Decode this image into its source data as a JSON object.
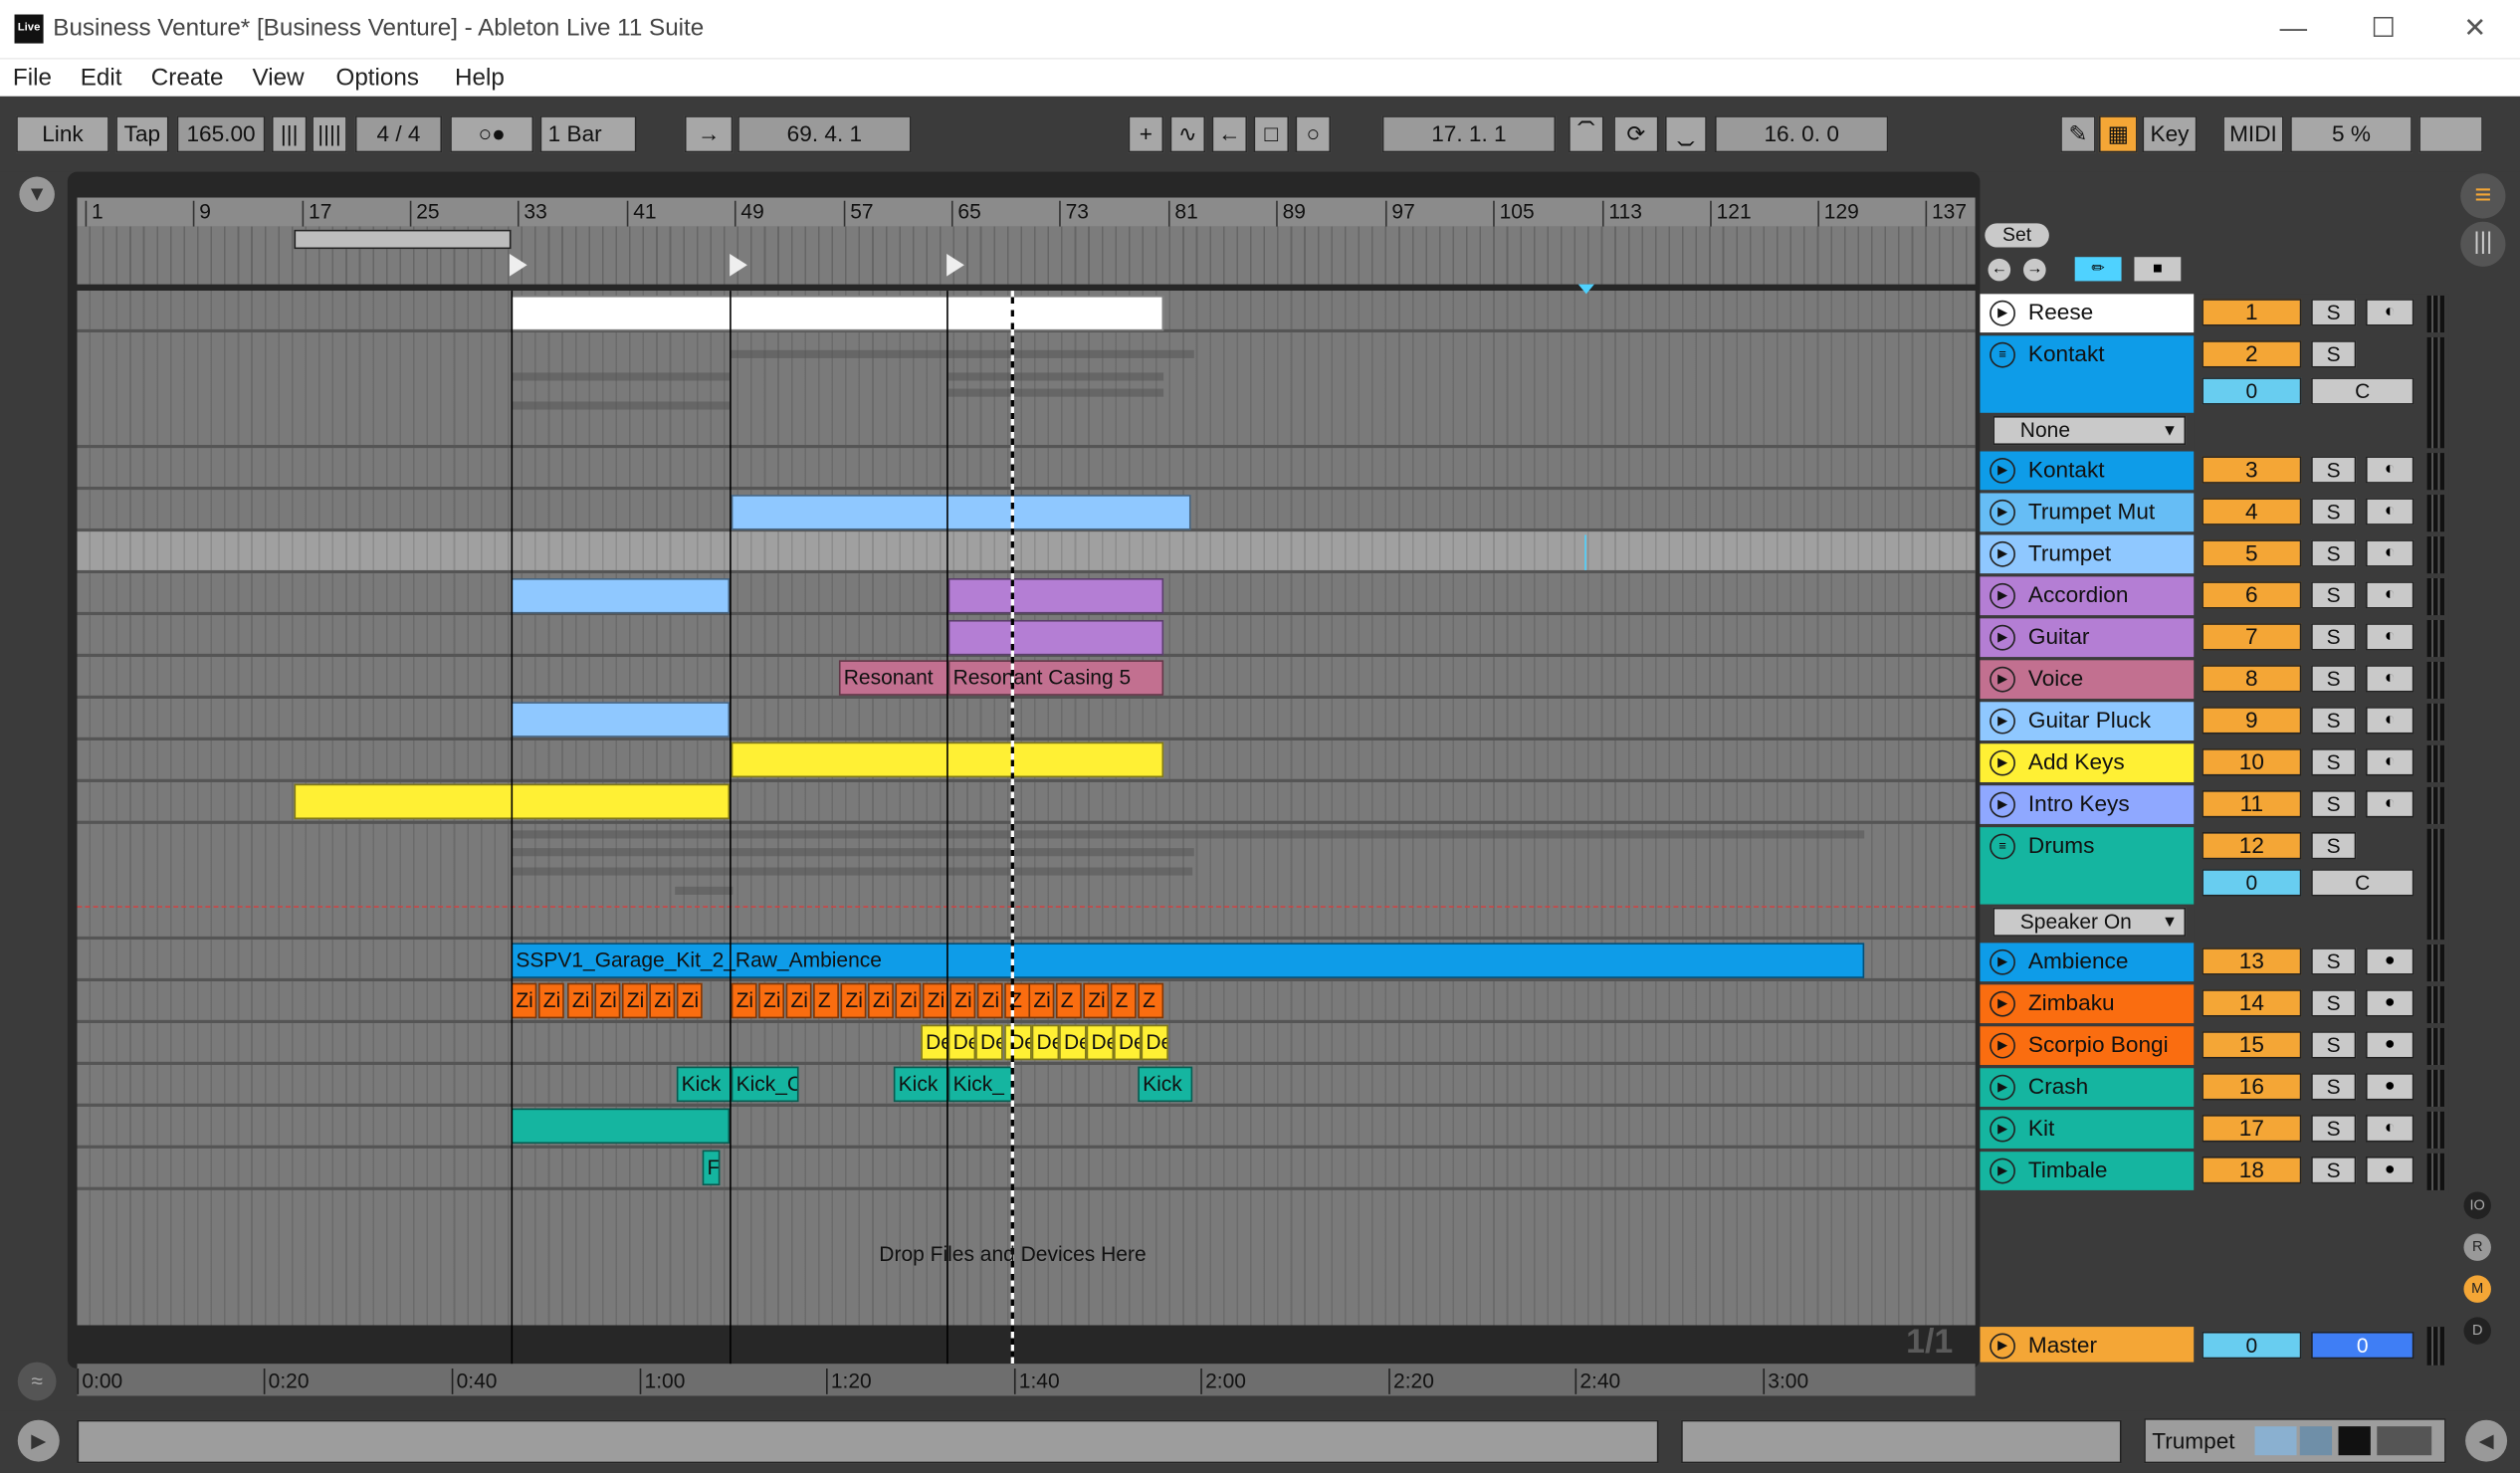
{
  "window": {
    "title": "Business Venture*  [Business Venture] - Ableton Live 11 Suite",
    "logo_text": "Live"
  },
  "menu": [
    "File",
    "Edit",
    "Create",
    "View",
    "Options",
    "Help"
  ],
  "transport": {
    "link": "Link",
    "tap": "Tap",
    "tempo": "165.00",
    "signature": "4 / 4",
    "metro_mode": "○●",
    "quantize": "1 Bar",
    "position": "69.   4.   1",
    "punch_in": "17.   1.   1",
    "punch_length": "16.   0.   0",
    "key": "Key",
    "midi": "MIDI",
    "cpu": "5 %"
  },
  "beat_ruler": [
    "1",
    "9",
    "17",
    "25",
    "33",
    "41",
    "49",
    "57",
    "65",
    "73",
    "81",
    "89",
    "97",
    "105",
    "113",
    "121",
    "129",
    "137"
  ],
  "time_ruler": [
    "0:00",
    "0:20",
    "0:40",
    "1:00",
    "1:20",
    "1:40",
    "2:00",
    "2:20",
    "2:40",
    "3:00"
  ],
  "arrangement": {
    "clips": [
      {
        "name": "",
        "color": "#ffffff",
        "text": ""
      },
      {
        "name": "",
        "color": "#8fc8ff",
        "text": ""
      },
      {
        "name": "",
        "color": "#8fc8ff",
        "text": ""
      },
      {
        "name": "",
        "color": "#b47ed4",
        "text": ""
      },
      {
        "name": "",
        "color": "#b47ed4",
        "text": ""
      },
      {
        "name": "",
        "color": "#c27090",
        "text": "Resonant"
      },
      {
        "name": "",
        "color": "#c27090",
        "text": "Resonant Casing 5"
      },
      {
        "name": "",
        "color": "#8fc8ff",
        "text": ""
      },
      {
        "name": "",
        "color": "#fff034",
        "text": ""
      },
      {
        "name": "",
        "color": "#fff034",
        "text": ""
      },
      {
        "name": "",
        "color": "#0e9ce8",
        "text": "SSPV1_Garage_Kit_2_Raw_Ambience"
      },
      {
        "name": "",
        "color": "#15b5a0",
        "text": ""
      },
      {
        "name": "",
        "color": "#15b5a0",
        "text": "F"
      }
    ],
    "zimbaku_labels": [
      "Zi",
      "Zi",
      "Zi",
      "Zi",
      "Zi",
      "Zi",
      "Zi",
      "Zi",
      "Zi",
      "Zi",
      "Z",
      "Zi",
      "Zi",
      "Zi",
      "Zi",
      "Zi",
      "Zi",
      "Z",
      "Zi",
      "Z",
      "Zi",
      "Z",
      "Z"
    ],
    "scorpio_labels": [
      "De",
      "De",
      "De",
      "De",
      "De",
      "De",
      "De",
      "De",
      "De"
    ],
    "kick_labels": [
      "Kick",
      "Kick_C",
      "Kick",
      "Kick_",
      "Kick"
    ],
    "drop_hint": "Drop Files and Devices Here",
    "zoom": "1/1"
  },
  "sidebar": {
    "set": "Set"
  },
  "tracks": [
    {
      "name": "Reese",
      "num": "1",
      "color": "#ffffff"
    },
    {
      "name": "Kontakt",
      "num": "2",
      "color": "#0e9ce8",
      "group": true,
      "vol": "0",
      "pan": "C",
      "select": "None"
    },
    {
      "name": "Kontakt",
      "num": "3",
      "color": "#0e9ce8"
    },
    {
      "name": "Trumpet Mut",
      "num": "4",
      "color": "#66bdf5"
    },
    {
      "name": "Trumpet",
      "num": "5",
      "color": "#8fc8ff"
    },
    {
      "name": "Accordion",
      "num": "6",
      "color": "#b47ed4"
    },
    {
      "name": "Guitar",
      "num": "7",
      "color": "#b47ed4"
    },
    {
      "name": "Voice",
      "num": "8",
      "color": "#c27090"
    },
    {
      "name": "Guitar Pluck",
      "num": "9",
      "color": "#8fc8ff"
    },
    {
      "name": "Add Keys",
      "num": "10",
      "color": "#fff034"
    },
    {
      "name": "Intro Keys",
      "num": "11",
      "color": "#8fa8ff"
    },
    {
      "name": "Drums",
      "num": "12",
      "color": "#15b5a0",
      "group": true,
      "vol": "0",
      "pan": "C",
      "select": "Speaker On"
    },
    {
      "name": "Ambience",
      "num": "13",
      "color": "#0e9ce8"
    },
    {
      "name": "Zimbaku",
      "num": "14",
      "color": "#fa6d10"
    },
    {
      "name": "Scorpio Bongi",
      "num": "15",
      "color": "#fa6d10"
    },
    {
      "name": "Crash",
      "num": "16",
      "color": "#15b5a0"
    },
    {
      "name": "Kit",
      "num": "17",
      "color": "#15b5a0"
    },
    {
      "name": "Timbale",
      "num": "18",
      "color": "#15b5a0"
    }
  ],
  "master": {
    "name": "Master",
    "vol": "0",
    "pan": "0",
    "color": "#f4a636"
  },
  "status": {
    "device_label": "Trumpet"
  },
  "solo_label": "S"
}
